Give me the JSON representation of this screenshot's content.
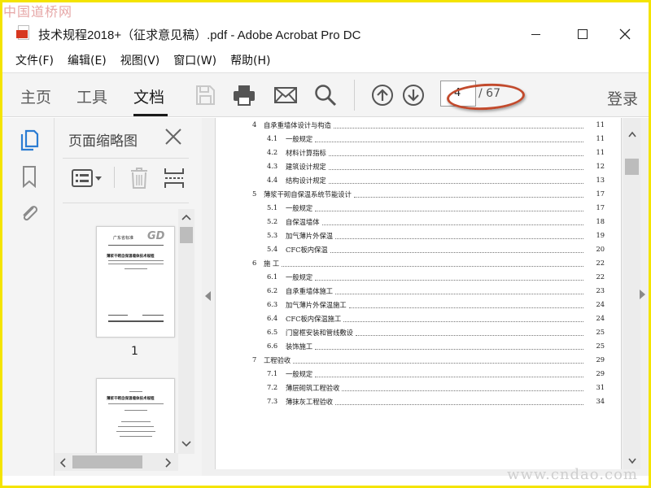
{
  "watermarks": {
    "top": "中国道桥网",
    "bottom": "www.cndao.com"
  },
  "window": {
    "title": "技术规程2018+（征求意见稿）.pdf - Adobe Acrobat Pro DC",
    "controls": {
      "minimize": "—",
      "maximize": "☐",
      "close": "✕"
    }
  },
  "menu": [
    "文件(F)",
    "编辑(E)",
    "视图(V)",
    "窗口(W)",
    "帮助(H)"
  ],
  "toolbar": {
    "tabs": [
      {
        "label": "主页",
        "active": false
      },
      {
        "label": "工具",
        "active": false
      },
      {
        "label": "文档",
        "active": true
      }
    ],
    "icons": [
      "save-icon",
      "print-icon",
      "email-icon",
      "search-icon",
      "page-up-icon",
      "page-down-icon"
    ],
    "current_page": "4",
    "page_total": "/ 67",
    "login": "登录"
  },
  "rail": {
    "icons": [
      "pages-icon",
      "bookmark-icon",
      "attachment-icon"
    ]
  },
  "thumbnails": {
    "title": "页面缩略图",
    "items": [
      {
        "label": "1",
        "header_left": "广东省标准",
        "logo": "GD",
        "heading": "薄浆干砌自保温墙体技术规程"
      },
      {
        "label": "",
        "heading": "薄浆干砌自保温墙体技术规程"
      }
    ]
  },
  "toc": [
    {
      "num": "4",
      "text": "自承重墙体设计与构造",
      "page": "11",
      "level": 1
    },
    {
      "num": "4.1",
      "text": "一般规定",
      "page": "11",
      "level": 2
    },
    {
      "num": "4.2",
      "text": "材料计算指标",
      "page": "11",
      "level": 2
    },
    {
      "num": "4.3",
      "text": "建筑设计规定",
      "page": "12",
      "level": 2
    },
    {
      "num": "4.4",
      "text": "结构设计规定",
      "page": "13",
      "level": 2
    },
    {
      "num": "5",
      "text": "薄浆干砌自保温系统节能设计",
      "page": "17",
      "level": 1
    },
    {
      "num": "5.1",
      "text": "一般规定",
      "page": "17",
      "level": 2
    },
    {
      "num": "5.2",
      "text": "自保温墙体",
      "page": "18",
      "level": 2
    },
    {
      "num": "5.3",
      "text": "加气薄片外保温",
      "page": "19",
      "level": 2
    },
    {
      "num": "5.4",
      "text": "CFC板内保温",
      "page": "20",
      "level": 2
    },
    {
      "num": "6",
      "text": "施  工",
      "page": "22",
      "level": 1
    },
    {
      "num": "6.1",
      "text": "一般规定",
      "page": "22",
      "level": 2
    },
    {
      "num": "6.2",
      "text": "自承重墙体施工",
      "page": "23",
      "level": 2
    },
    {
      "num": "6.3",
      "text": "加气薄片外保温施工",
      "page": "24",
      "level": 2
    },
    {
      "num": "6.4",
      "text": "CFC板内保温施工",
      "page": "24",
      "level": 2
    },
    {
      "num": "6.5",
      "text": "门窗框安装和管线敷设",
      "page": "25",
      "level": 2
    },
    {
      "num": "6.6",
      "text": "装饰施工",
      "page": "25",
      "level": 2
    },
    {
      "num": "7",
      "text": "工程验收",
      "page": "29",
      "level": 1
    },
    {
      "num": "7.1",
      "text": "一般规定",
      "page": "29",
      "level": 2
    },
    {
      "num": "7.2",
      "text": "薄层砌筑工程验收",
      "page": "31",
      "level": 2
    },
    {
      "num": "7.3",
      "text": "薄抹灰工程验收",
      "page": "34",
      "level": 2
    }
  ],
  "colors": {
    "annotation": "#c24a2c",
    "frame": "#f4e400",
    "pdf_red": "#d7371f"
  }
}
